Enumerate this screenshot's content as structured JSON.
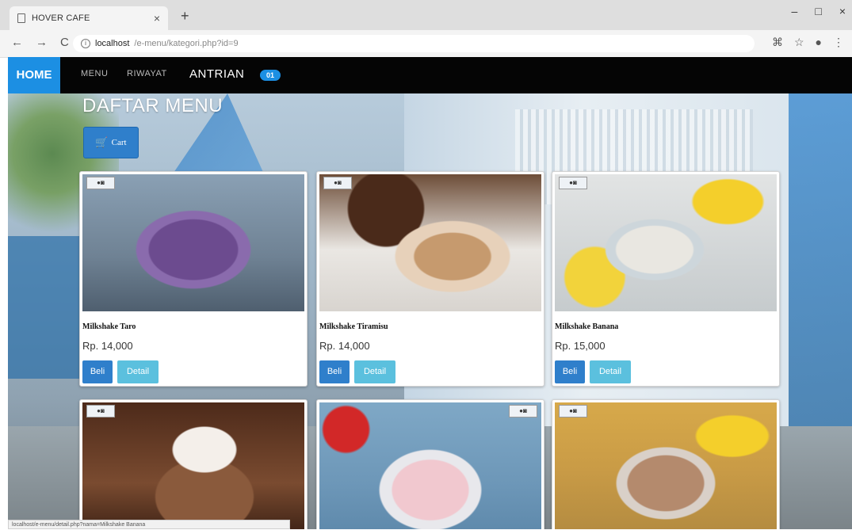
{
  "browser": {
    "tab_title": "HOVER CAFE",
    "tab_close": "×",
    "new_tab": "+",
    "url_host": "localhost",
    "url_path": "/e-menu/kategori.php?id=9",
    "back": "←",
    "forward": "→",
    "reload": "C",
    "window_controls": [
      "–",
      "□",
      "×"
    ]
  },
  "navbar": {
    "home": "HOME",
    "menu": "MENU",
    "riwayat": "RIWAYAT",
    "antrian": "ANTRIAN",
    "antrian_count": "01"
  },
  "page": {
    "heading": "DAFTAR MENU",
    "cart_label": "Cart"
  },
  "products": [
    {
      "name": "Milkshake Taro",
      "price": "Rp. 14,000",
      "buy": "Beli",
      "detail": "Detail"
    },
    {
      "name": "Milkshake Tiramisu",
      "price": "Rp. 14,000",
      "buy": "Beli",
      "detail": "Detail"
    },
    {
      "name": "Milkshake Banana",
      "price": "Rp. 15,000",
      "buy": "Beli",
      "detail": "Detail"
    }
  ],
  "status_bar": "localhost/e-menu/detail.php?nama=Milkshake Banana",
  "colors": {
    "primary": "#1c8fe3",
    "navbar_bg": "#050505",
    "beli_button": "#2f7fcb",
    "detail_button": "#5bc0de"
  }
}
